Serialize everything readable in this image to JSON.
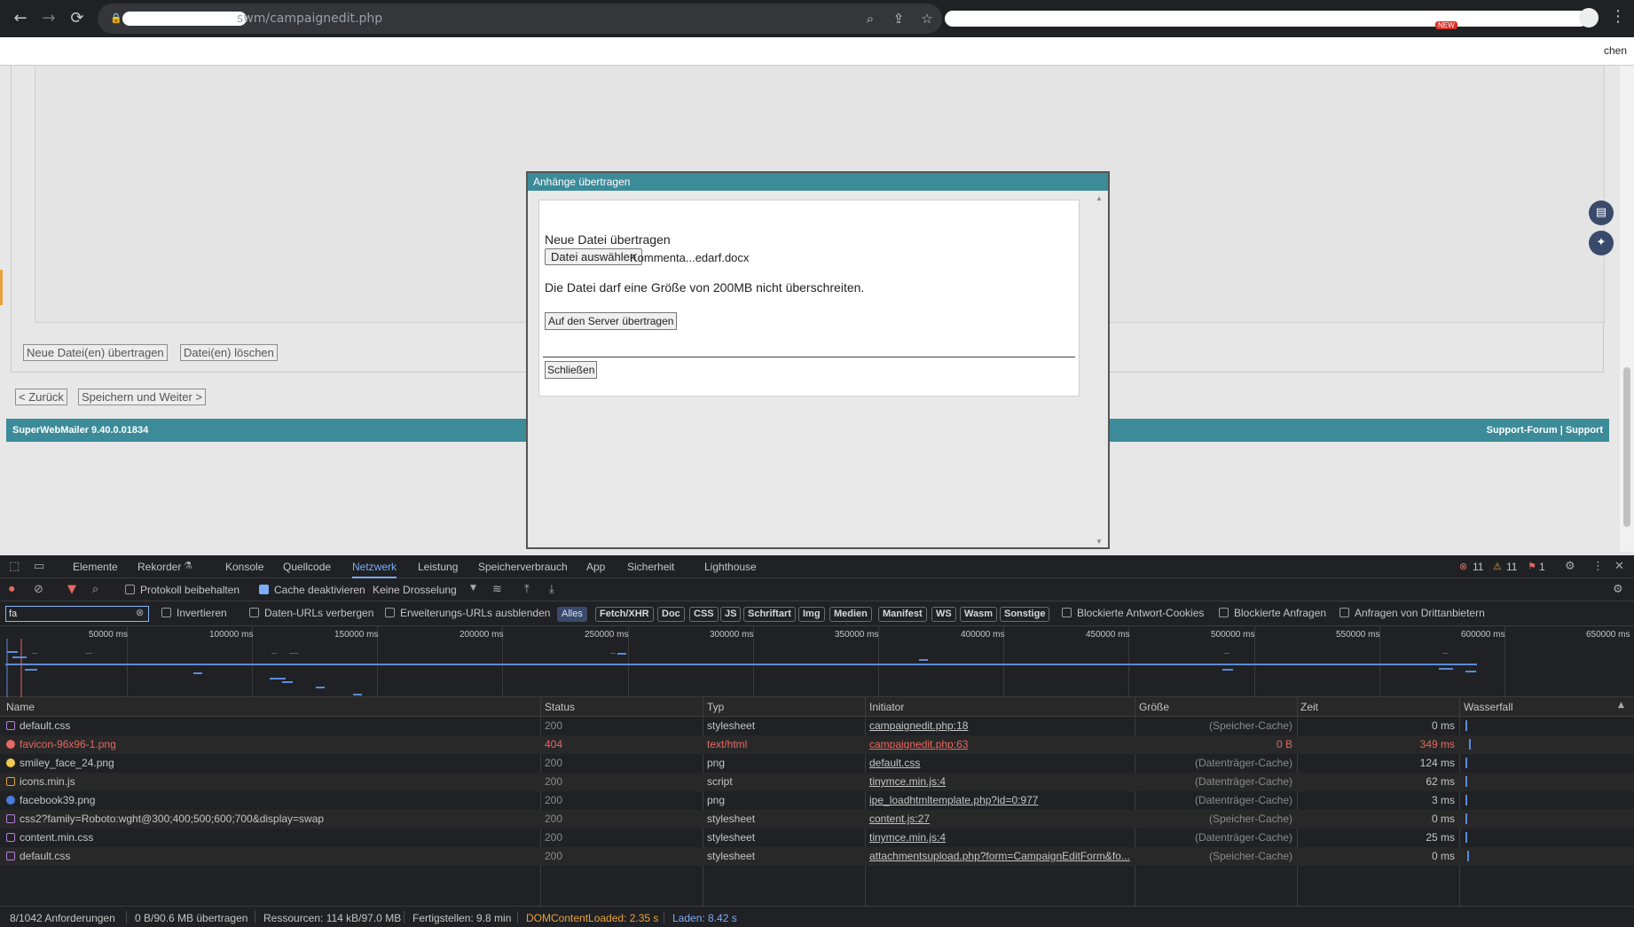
{
  "browser": {
    "url_suffix": "swm/campaignedit.php",
    "new_badge": "NEW",
    "bookmark_tail": "chen"
  },
  "page": {
    "buttons": {
      "new_files": "Neue Datei(en) übertragen",
      "delete_files": "Datei(en) löschen",
      "back": "< Zurück",
      "save_next": "Speichern und Weiter >"
    },
    "footer": {
      "version": "SuperWebMailer 9.40.0.01834",
      "links": "Support-Forum | Support"
    }
  },
  "dialog": {
    "title": "Anhänge übertragen",
    "heading": "Neue Datei übertragen",
    "choose_button": "Datei auswählen",
    "file_name": "Kommenta...edarf.docx",
    "size_note": "Die Datei darf eine Größe von 200MB nicht überschreiten.",
    "upload_button": "Auf den Server übertragen",
    "close_button": "Schließen"
  },
  "devtools": {
    "tabs": [
      "Elemente",
      "Rekorder",
      "Konsole",
      "Quellcode",
      "Netzwerk",
      "Leistung",
      "Speicherverbrauch",
      "App",
      "Sicherheit",
      "Lighthouse"
    ],
    "active_tab": "Netzwerk",
    "counts": {
      "errors": "11",
      "warnings": "11",
      "issues": "1"
    },
    "toolbar": {
      "preserve_log": "Protokoll beibehalten",
      "disable_cache": "Cache deaktivieren",
      "throttling": "Keine Drosselung"
    },
    "filter": {
      "value": "fa",
      "invert": "Invertieren",
      "hide_data_urls": "Daten-URLs verbergen",
      "hide_ext_urls": "Erweiterungs-URLs ausblenden",
      "types": [
        "Alles",
        "Fetch/XHR",
        "Doc",
        "CSS",
        "JS",
        "Schriftart",
        "Img",
        "Medien",
        "Manifest",
        "WS",
        "Wasm",
        "Sonstige"
      ],
      "blocked_cookies": "Blockierte Antwort-Cookies",
      "blocked_requests": "Blockierte Anfragen",
      "third_party": "Anfragen von Drittanbietern"
    },
    "overview_ticks": [
      "50000 ms",
      "100000 ms",
      "150000 ms",
      "200000 ms",
      "250000 ms",
      "300000 ms",
      "350000 ms",
      "400000 ms",
      "450000 ms",
      "500000 ms",
      "550000 ms",
      "600000 ms",
      "650000 ms"
    ],
    "columns": [
      "Name",
      "Status",
      "Typ",
      "Initiator",
      "Größe",
      "Zeit",
      "Wasserfall"
    ],
    "rows": [
      {
        "name": "default.css",
        "status": "200",
        "type": "stylesheet",
        "initiator": "campaignedit.php:18",
        "size": "(Speicher-Cache)",
        "time": "0 ms",
        "icon": "css"
      },
      {
        "name": "favicon-96x96-1.png",
        "status": "404",
        "type": "text/html",
        "initiator": "campaignedit.php:63",
        "size": "0 B",
        "time": "349 ms",
        "icon": "err"
      },
      {
        "name": "smiley_face_24.png",
        "status": "200",
        "type": "png",
        "initiator": "default.css",
        "size": "(Datenträger-Cache)",
        "time": "124 ms",
        "icon": "img"
      },
      {
        "name": "icons.min.js",
        "status": "200",
        "type": "script",
        "initiator": "tinymce.min.js:4",
        "size": "(Datenträger-Cache)",
        "time": "62 ms",
        "icon": "js"
      },
      {
        "name": "facebook39.png",
        "status": "200",
        "type": "png",
        "initiator": "ipe_loadhtmltemplate.php?id=0:977",
        "size": "(Datenträger-Cache)",
        "time": "3 ms",
        "icon": "fb"
      },
      {
        "name": "css2?family=Roboto:wght@300;400;500;600;700&display=swap",
        "status": "200",
        "type": "stylesheet",
        "initiator": "content.js:27",
        "size": "(Speicher-Cache)",
        "time": "0 ms",
        "icon": "css"
      },
      {
        "name": "content.min.css",
        "status": "200",
        "type": "stylesheet",
        "initiator": "tinymce.min.js:4",
        "size": "(Datenträger-Cache)",
        "time": "25 ms",
        "icon": "css"
      },
      {
        "name": "default.css",
        "status": "200",
        "type": "stylesheet",
        "initiator": "attachmentsupload.php?form=CampaignEditForm&fo...",
        "size": "(Speicher-Cache)",
        "time": "0 ms",
        "icon": "css"
      }
    ],
    "status_bar": {
      "requests": "8/1042 Anforderungen",
      "transferred": "0 B/90.6 MB übertragen",
      "resources": "Ressourcen: 114 kB/97.0 MB",
      "finish": "Fertigstellen: 9.8 min",
      "dom_loaded": "DOMContentLoaded: 2.35 s",
      "load": "Laden: 8.42 s"
    },
    "colors": {
      "dom_loaded": "#e8a33a",
      "load": "#7cacf8",
      "error": "#e46962"
    }
  }
}
